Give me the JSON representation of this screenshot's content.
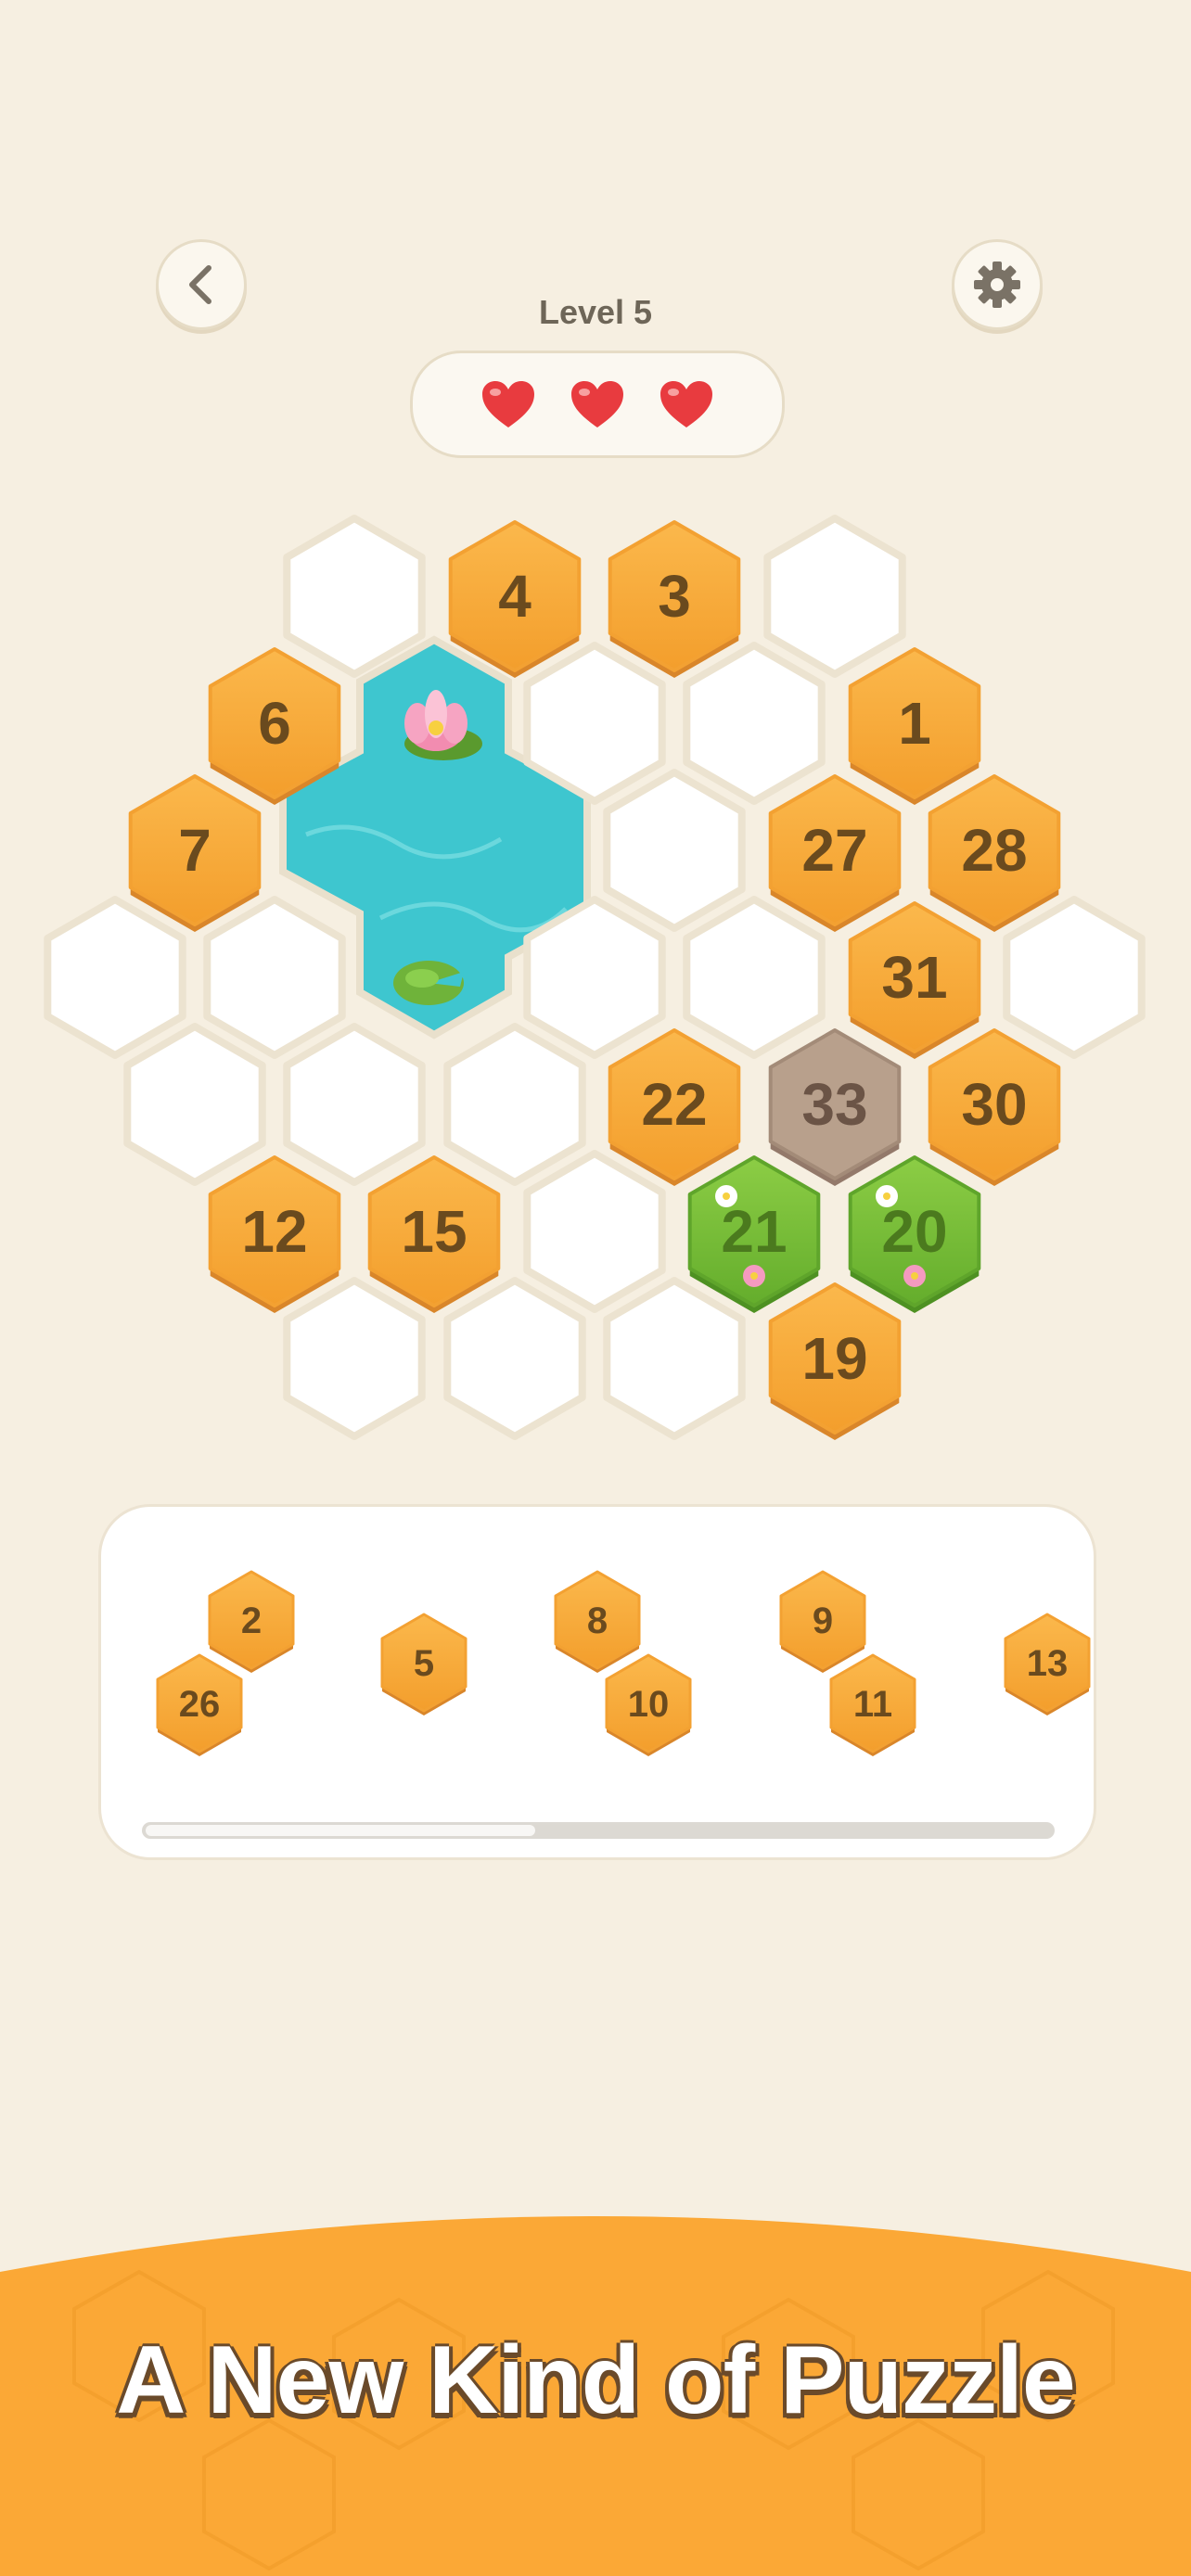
{
  "header": {
    "level_title": "Level 5",
    "lives": 3,
    "back_icon": "chevron-left-icon",
    "settings_icon": "gear-icon"
  },
  "board": {
    "tiles": [
      {
        "type": "empty",
        "col": 4,
        "row": 0
      },
      {
        "type": "number",
        "col": 5,
        "row": -0.5,
        "label": "4"
      },
      {
        "type": "number",
        "col": 6,
        "row": -0.5,
        "label": "3"
      },
      {
        "type": "empty",
        "col": 7,
        "row": 0
      },
      {
        "type": "number",
        "col": 1,
        "row": 1,
        "label": "6"
      },
      {
        "type": "empty",
        "col": 3,
        "row": 1
      },
      {
        "type": "empty",
        "col": 4,
        "row": 1
      },
      {
        "type": "number",
        "col": 5,
        "row": 1,
        "label": "1"
      },
      {
        "type": "number",
        "col": 0,
        "row": 2,
        "label": "7"
      },
      {
        "type": "empty",
        "col": 3,
        "row": 2
      },
      {
        "type": "number",
        "col": 4,
        "row": 2,
        "label": "27"
      },
      {
        "type": "number",
        "col": 5,
        "row": 2,
        "label": "28"
      },
      {
        "type": "empty",
        "col": -1,
        "row": 3
      },
      {
        "type": "empty",
        "col": 0,
        "row": 3
      },
      {
        "type": "empty",
        "col": 2,
        "row": 3
      },
      {
        "type": "empty",
        "col": 3,
        "row": 3
      },
      {
        "type": "number",
        "col": 4,
        "row": 3,
        "label": "31"
      },
      {
        "type": "empty",
        "col": 5,
        "row": 3
      },
      {
        "type": "empty",
        "col": -1,
        "row": 4
      },
      {
        "type": "empty",
        "col": 0,
        "row": 4
      },
      {
        "type": "empty",
        "col": 1,
        "row": 4
      },
      {
        "type": "number",
        "col": 2,
        "row": 4,
        "label": "22"
      },
      {
        "type": "stone",
        "col": 3,
        "row": 4,
        "label": "33"
      },
      {
        "type": "number",
        "col": 4,
        "row": 4,
        "label": "30"
      },
      {
        "type": "number",
        "col": -1,
        "row": 5,
        "label": "12"
      },
      {
        "type": "number",
        "col": 0,
        "row": 5,
        "label": "15"
      },
      {
        "type": "empty",
        "col": 1,
        "row": 5
      },
      {
        "type": "grass",
        "col": 2,
        "row": 5,
        "label": "21"
      },
      {
        "type": "grass",
        "col": 3,
        "row": 5,
        "label": "20"
      },
      {
        "type": "empty",
        "col": -1,
        "row": 6
      },
      {
        "type": "empty",
        "col": 0,
        "row": 6
      },
      {
        "type": "empty",
        "col": 1,
        "row": 6
      },
      {
        "type": "number",
        "col": 2,
        "row": 6,
        "label": "19"
      }
    ]
  },
  "tray": {
    "pieces": [
      "2",
      "26",
      "5",
      "8",
      "10",
      "9",
      "11",
      "13"
    ]
  },
  "banner": {
    "tagline": "A New Kind of Puzzle"
  },
  "colors": {
    "background": "#f6efe1",
    "tile_orange": "#f7a93a",
    "tile_number": "#6a4a1e",
    "water": "#3ec6cf",
    "grass": "#79bf3a",
    "stone": "#b49c88",
    "heart": "#e83b3f",
    "banner": "#fba836"
  }
}
